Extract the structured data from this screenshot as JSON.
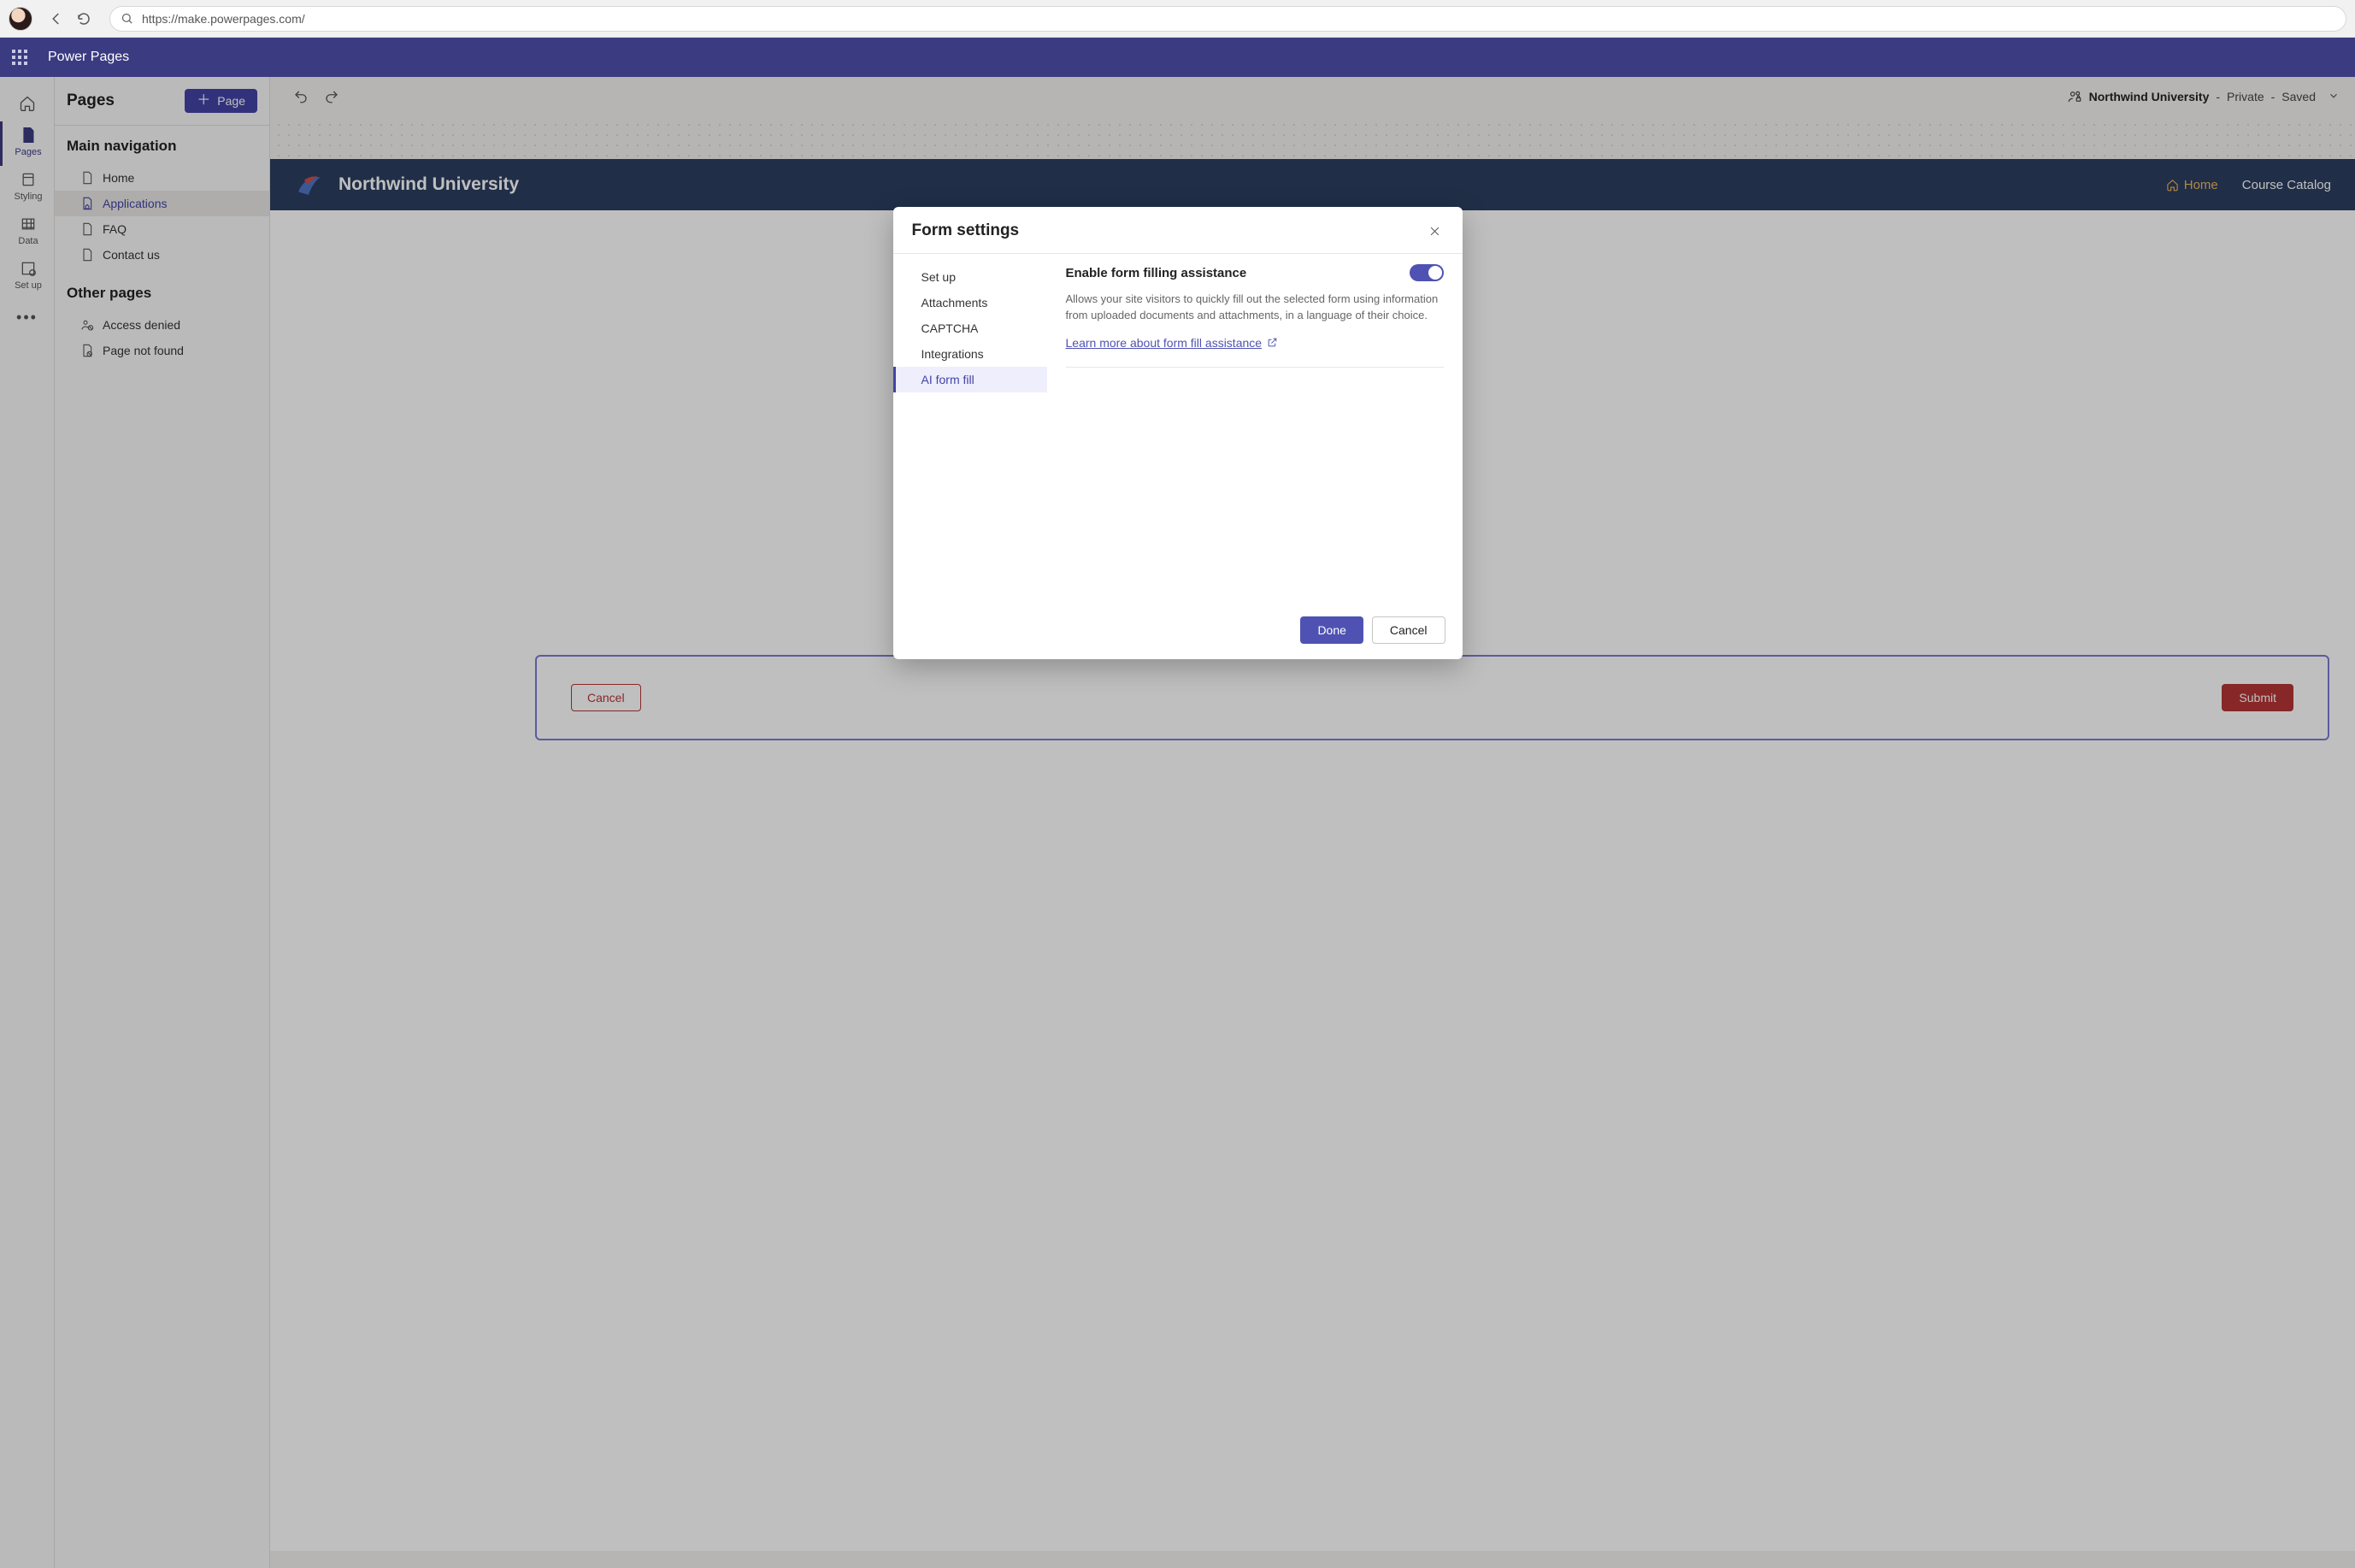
{
  "browser": {
    "url": "https://make.powerpages.com/"
  },
  "appbar": {
    "product": "Power Pages"
  },
  "leftRail": {
    "items": [
      {
        "id": "pages",
        "label": "Pages",
        "active": true
      },
      {
        "id": "styling",
        "label": "Styling",
        "active": false
      },
      {
        "id": "data",
        "label": "Data",
        "active": false
      },
      {
        "id": "setup",
        "label": "Set up",
        "active": false
      }
    ]
  },
  "pagesPanel": {
    "title": "Pages",
    "addButton": "Page",
    "mainNavHeading": "Main navigation",
    "mainNav": [
      {
        "id": "home",
        "label": "Home"
      },
      {
        "id": "applications",
        "label": "Applications",
        "selected": true
      },
      {
        "id": "faq",
        "label": "FAQ"
      },
      {
        "id": "contact",
        "label": "Contact us"
      }
    ],
    "otherPagesHeading": "Other pages",
    "otherPages": [
      {
        "id": "access-denied",
        "label": "Access denied"
      },
      {
        "id": "page-not-found",
        "label": "Page not found"
      }
    ]
  },
  "statusBar": {
    "siteName": "Northwind University",
    "visibility": "Private",
    "saveState": "Saved"
  },
  "sitePreview": {
    "title": "Northwind University",
    "nav": {
      "home": "Home",
      "courseCatalog": "Course Catalog"
    },
    "form": {
      "cancel": "Cancel",
      "submit": "Submit"
    }
  },
  "modal": {
    "title": "Form settings",
    "nav": [
      {
        "id": "setup",
        "label": "Set up"
      },
      {
        "id": "attachments",
        "label": "Attachments"
      },
      {
        "id": "captcha",
        "label": "CAPTCHA"
      },
      {
        "id": "integrations",
        "label": "Integrations"
      },
      {
        "id": "ai-form-fill",
        "label": "AI form fill",
        "selected": true
      }
    ],
    "toggleLabel": "Enable form filling assistance",
    "toggleOn": true,
    "description": "Allows your site visitors to quickly fill out the selected form using information from uploaded documents and attachments, in a language of their choice.",
    "learnMore": "Learn more about form fill assistance",
    "doneButton": "Done",
    "cancelButton": "Cancel"
  }
}
